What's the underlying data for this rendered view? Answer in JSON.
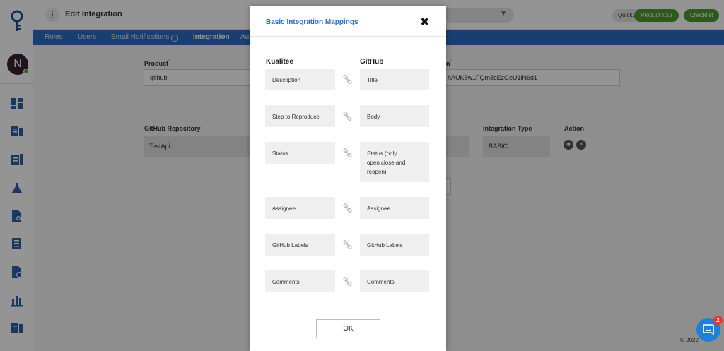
{
  "header": {
    "title": "Edit Integration",
    "quick_actions": "Quick Actions",
    "product_tour": "Product Tour",
    "checklist": "Checklist"
  },
  "user": {
    "avatar_initial": "N"
  },
  "tabs": [
    {
      "label": "Roles"
    },
    {
      "label": "Users"
    },
    {
      "label": "Email Notifications"
    },
    {
      "label": "Integration"
    },
    {
      "label": "Au"
    }
  ],
  "form": {
    "product_label": "Product",
    "product_value": "github",
    "token_label_fragment": "n",
    "token_value_fragment": "hAUK8w1FQm8cEzGeU1lN6d1",
    "repo_label": "GitHub Repository",
    "repo_value": "TestApi",
    "integration_type_label": "Integration Type",
    "integration_type_value": "BASIC",
    "action_label": "Action"
  },
  "footer": {
    "copyright_fragment": "© 2022"
  },
  "modal": {
    "title": "Basic Integration Mappings",
    "left_header": "Kualitee",
    "right_header": "GitHub",
    "mappings": [
      {
        "left": "Description",
        "right": "Title"
      },
      {
        "left": "Step to Reproduce",
        "right": "Body"
      },
      {
        "left": "Status",
        "right": "Status (only open,close and reopen)"
      },
      {
        "left": "Assignee",
        "right": "Assignee"
      },
      {
        "left": "GitHub Labels",
        "right": "GitHub Labels"
      },
      {
        "left": "Comments",
        "right": "Comments"
      }
    ],
    "ok_label": "OK"
  },
  "chat": {
    "badge_count": "2"
  },
  "colors": {
    "tab_bar": "#2d6cc0",
    "green_button": "#4e9a2e",
    "modal_title": "#2d6cc0",
    "chat": "#1f80d6",
    "badge": "#e53935"
  }
}
